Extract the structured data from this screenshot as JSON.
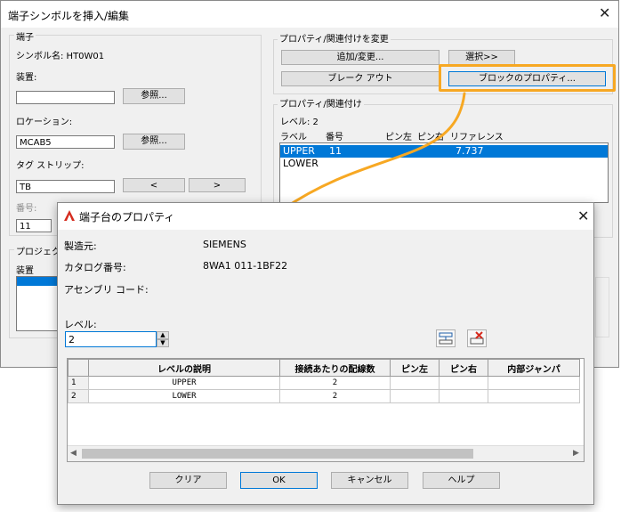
{
  "dialog1": {
    "title": "端子シンボルを挿入/編集",
    "terminal_group": {
      "label": "端子",
      "symbol_name": "シンボル名: HT0W01",
      "device_label": "装置:",
      "device_value": "",
      "browse1": "参照...",
      "location_label": "ロケーション:",
      "location_value": "MCAB5",
      "browse2": "参照...",
      "tagstrip_label": "タグ ストリップ:",
      "tagstrip_value": "TB",
      "prev": "<",
      "next": ">",
      "number_label": "番号:",
      "number_value": "11"
    },
    "project_group": {
      "label": "プロジェクト",
      "device_label": "装置"
    },
    "change_group": {
      "label": "プロパティ/関連付けを変更",
      "add_change": "追加/変更...",
      "select": "選択>>",
      "break_out": "ブレーク アウト",
      "block_props": "ブロックのプロパティ..."
    },
    "assoc_group": {
      "label": "プロパティ/関連付け",
      "level_text": "レベル:  2",
      "headers": [
        "ラベル",
        "番号",
        "ピン左",
        "ピン右",
        "リファレンス"
      ],
      "rows": [
        {
          "label": "UPPER",
          "number": "11",
          "ref": "7.737"
        },
        {
          "label": "LOWER",
          "number": "",
          "ref": ""
        }
      ]
    }
  },
  "dialog2": {
    "title": "端子台のプロパティ",
    "manufacturer_label": "製造元:",
    "manufacturer_value": "SIEMENS",
    "catalog_label": "カタログ番号:",
    "catalog_value": "8WA1 011-1BF22",
    "assembly_label": "アセンブリ コード:",
    "level_label": "レベル:",
    "level_value": "2",
    "grid": {
      "headers": [
        "レベルの説明",
        "接続あたりの配線数",
        "ピン左",
        "ピン右",
        "内部ジャンパ"
      ],
      "rows": [
        {
          "num": "1",
          "desc": "UPPER",
          "wires": "2",
          "pin_left": "",
          "pin_right": "",
          "jumper": ""
        },
        {
          "num": "2",
          "desc": "LOWER",
          "wires": "2",
          "pin_left": "",
          "pin_right": "",
          "jumper": ""
        }
      ]
    },
    "buttons": {
      "clear": "クリア",
      "ok": "OK",
      "cancel": "キャンセル",
      "help": "ヘルプ"
    }
  },
  "colors": {
    "highlight": "#f7a823",
    "selection": "#0078d7",
    "autocad_red": "#d52b1e"
  }
}
